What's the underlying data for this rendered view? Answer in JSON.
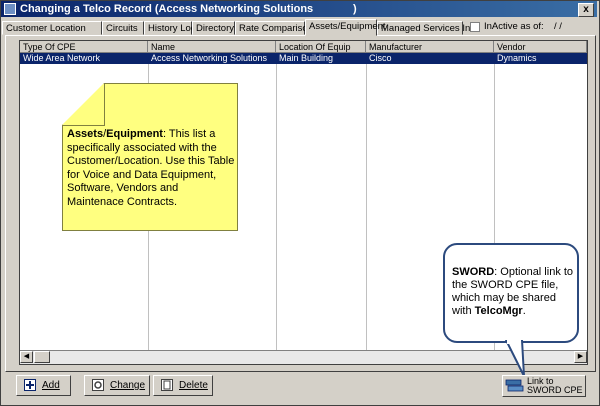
{
  "window": {
    "title": "Changing a Telco Record  (Access Networking Solutions",
    "title_suffix": ")",
    "close_label": "x"
  },
  "tabs": [
    {
      "label": "Customer Location"
    },
    {
      "label": "Circuits"
    },
    {
      "label": "History Log"
    },
    {
      "label": "Directory"
    },
    {
      "label": "Rate Comparison"
    },
    {
      "label": "Assets/Equipment"
    },
    {
      "label": "Managed Services Info"
    }
  ],
  "inactive": {
    "label": "InActive as of:",
    "value": "/ /"
  },
  "table": {
    "columns": [
      "Type Of CPE",
      "Name",
      "Location Of Equip",
      "Manufacturer",
      "Vendor"
    ],
    "rows": [
      [
        "Wide Area Network",
        "Access Networking Solutions",
        "Main Building",
        "Cisco",
        "Dynamics"
      ]
    ]
  },
  "note": {
    "bold": "Assets",
    "sep": "/",
    "bold2": "Equipment",
    "text": ": This list a specifically associated with the Customer/Location. Use this Table for Voice and Data Equipment, Software, Vendors and Maintenace Contracts."
  },
  "callout": {
    "bold": "SWORD",
    "text": ": Optional link to the SWORD CPE file, which may be shared with ",
    "bold2": "TelcoMgr",
    "end": "."
  },
  "buttons": {
    "add": "Add",
    "change": "Change",
    "delete": "Delete",
    "sword_line1": "Link to",
    "sword_line2": "SWORD CPE"
  }
}
